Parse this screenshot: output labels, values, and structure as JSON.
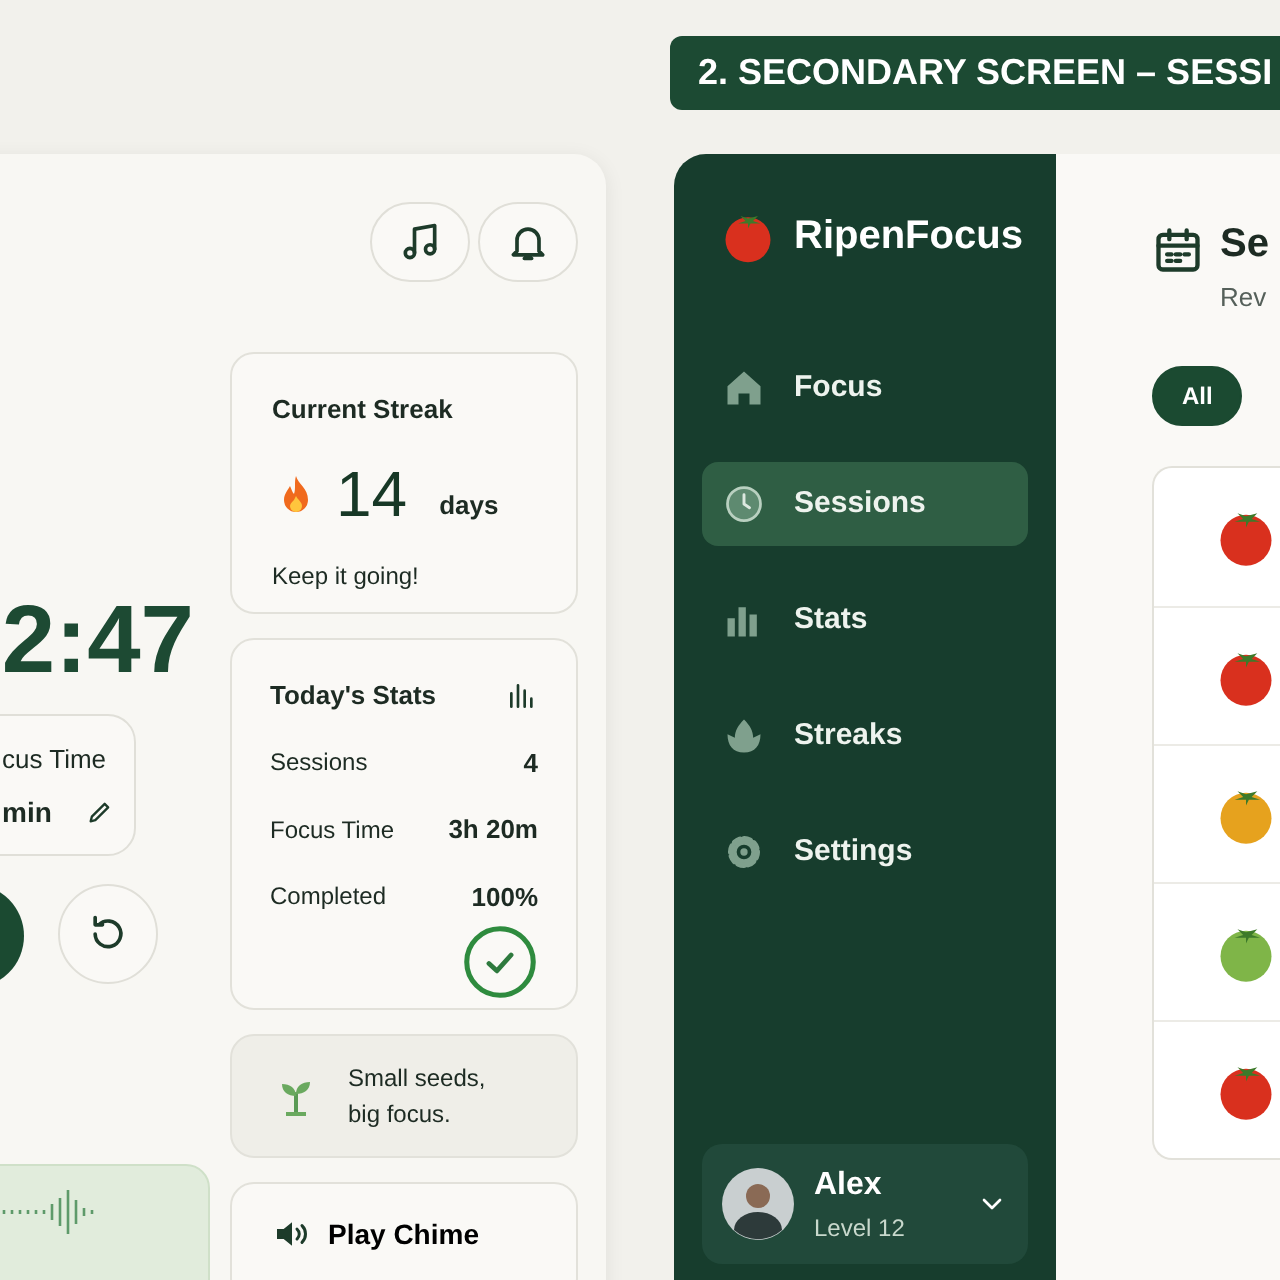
{
  "timer": {
    "time": "2:47",
    "focus_label": "cus Time",
    "focus_value": "min"
  },
  "streak": {
    "title": "Current Streak",
    "count": "14",
    "unit": "days",
    "message": "Keep it going!"
  },
  "stats": {
    "title": "Today's Stats",
    "rows": [
      {
        "label": "Sessions",
        "value": "4"
      },
      {
        "label": "Focus Time",
        "value": "3h 20m"
      },
      {
        "label": "Completed",
        "value": "100%"
      }
    ]
  },
  "tip": {
    "text": "Small seeds, big focus."
  },
  "chime": {
    "label": "Play Chime"
  },
  "banner": {
    "title": "2. SECONDARY SCREEN – SESSI"
  },
  "sidebar": {
    "brand": "RipenFocus",
    "items": [
      {
        "label": "Focus",
        "kind": "home",
        "selected": false
      },
      {
        "label": "Sessions",
        "kind": "clock",
        "selected": true
      },
      {
        "label": "Stats",
        "kind": "bars",
        "selected": false
      },
      {
        "label": "Streaks",
        "kind": "leaf",
        "selected": false
      },
      {
        "label": "Settings",
        "kind": "gear",
        "selected": false
      }
    ],
    "user": {
      "name": "Alex",
      "level": "Level 12"
    }
  },
  "content": {
    "title": "Se",
    "subtitle": "Rev",
    "filters": [
      {
        "label": "All",
        "selected": true
      }
    ],
    "sessions": [
      {
        "color": "#d9301e"
      },
      {
        "color": "#d9301e"
      },
      {
        "color": "#e6a21e"
      },
      {
        "color": "#7fb548"
      },
      {
        "color": "#d9301e"
      }
    ]
  }
}
